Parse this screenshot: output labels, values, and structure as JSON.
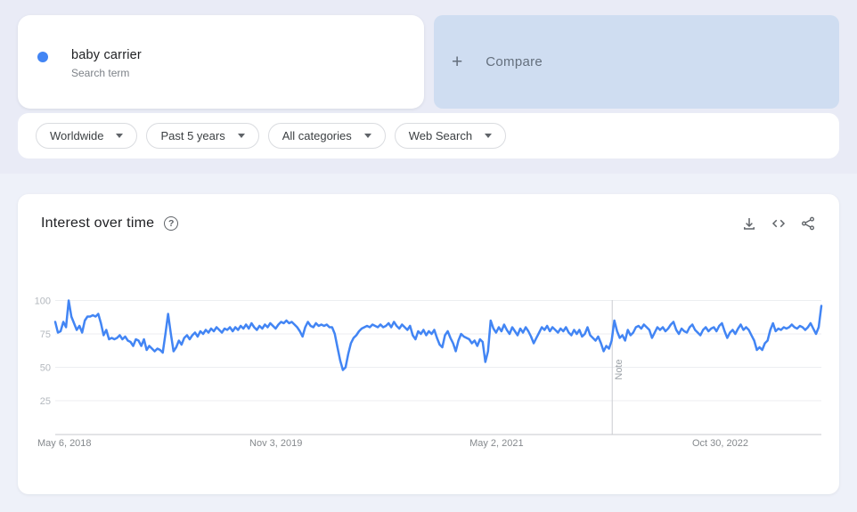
{
  "colors": {
    "accent_blue": "#4285f4",
    "compare_card_bg": "#cfddf1",
    "page_top_bg": "#e9ebf6",
    "page_bottom_bg": "#eef1f9"
  },
  "term_card": {
    "term": "baby carrier",
    "type_label": "Search term",
    "dot_color": "#4285f4"
  },
  "compare_card": {
    "plus": "+",
    "label": "Compare"
  },
  "filters": [
    {
      "label": "Worldwide"
    },
    {
      "label": "Past 5 years"
    },
    {
      "label": "All categories"
    },
    {
      "label": "Web Search"
    }
  ],
  "chart_panel": {
    "title": "Interest over time",
    "help": "?",
    "icons": [
      "download-icon",
      "embed-icon",
      "share-icon"
    ]
  },
  "chart_data": {
    "type": "line",
    "title": "Interest over time",
    "ylabel": "",
    "xlabel": "",
    "ylim": [
      0,
      100
    ],
    "y_ticks": [
      25,
      50,
      75,
      100
    ],
    "grid": true,
    "legend": "none",
    "x_ticks": [
      {
        "label": "May 6, 2018",
        "fraction": 0.0,
        "align": "left"
      },
      {
        "label": "Nov 3, 2019",
        "fraction": 0.288,
        "align": "center"
      },
      {
        "label": "May 2, 2021",
        "fraction": 0.576,
        "align": "center"
      },
      {
        "label": "Oct 30, 2022",
        "fraction": 0.868,
        "align": "center"
      }
    ],
    "note_marker": {
      "label": "Note",
      "fraction": 0.727
    },
    "series": [
      {
        "name": "baby carrier (Worldwide)",
        "color": "#4285f4",
        "values": [
          84,
          76,
          77,
          84,
          80,
          100,
          88,
          83,
          78,
          81,
          76,
          85,
          88,
          88,
          89,
          88,
          90,
          83,
          74,
          78,
          71,
          72,
          71,
          72,
          74,
          71,
          73,
          70,
          69,
          66,
          71,
          70,
          66,
          71,
          63,
          66,
          64,
          62,
          64,
          63,
          61,
          75,
          90,
          75,
          62,
          65,
          70,
          67,
          72,
          74,
          71,
          74,
          76,
          73,
          77,
          75,
          78,
          76,
          79,
          77,
          80,
          78,
          76,
          79,
          78,
          80,
          77,
          80,
          78,
          81,
          79,
          82,
          79,
          83,
          80,
          78,
          81,
          79,
          82,
          80,
          83,
          81,
          79,
          82,
          84,
          83,
          85,
          83,
          84,
          82,
          80,
          77,
          73,
          80,
          84,
          81,
          80,
          83,
          81,
          82,
          81,
          82,
          80,
          80,
          75,
          65,
          55,
          48,
          50,
          60,
          68,
          72,
          74,
          77,
          79,
          80,
          81,
          80,
          82,
          81,
          80,
          82,
          80,
          81,
          83,
          80,
          84,
          81,
          79,
          82,
          80,
          78,
          81,
          74,
          71,
          77,
          75,
          78,
          74,
          77,
          75,
          78,
          72,
          67,
          65,
          74,
          77,
          72,
          68,
          62,
          70,
          75,
          73,
          72,
          71,
          68,
          70,
          66,
          71,
          69,
          54,
          62,
          85,
          79,
          76,
          80,
          77,
          82,
          78,
          75,
          80,
          77,
          74,
          79,
          76,
          80,
          77,
          73,
          68,
          72,
          76,
          80,
          78,
          81,
          77,
          80,
          78,
          76,
          79,
          77,
          80,
          76,
          74,
          78,
          75,
          78,
          73,
          75,
          80,
          74,
          72,
          70,
          73,
          68,
          62,
          66,
          64,
          70,
          85,
          77,
          72,
          74,
          70,
          78,
          74,
          76,
          80,
          81,
          79,
          82,
          80,
          78,
          72,
          76,
          80,
          78,
          80,
          77,
          79,
          82,
          84,
          78,
          75,
          79,
          77,
          76,
          80,
          82,
          78,
          76,
          74,
          78,
          80,
          77,
          79,
          80,
          77,
          81,
          83,
          77,
          72,
          76,
          78,
          75,
          79,
          82,
          78,
          80,
          78,
          74,
          70,
          63,
          65,
          63,
          68,
          70,
          78,
          83,
          77,
          79,
          78,
          80,
          79,
          80,
          82,
          80,
          79,
          81,
          80,
          78,
          80,
          83,
          79,
          75,
          80,
          96
        ]
      }
    ]
  }
}
